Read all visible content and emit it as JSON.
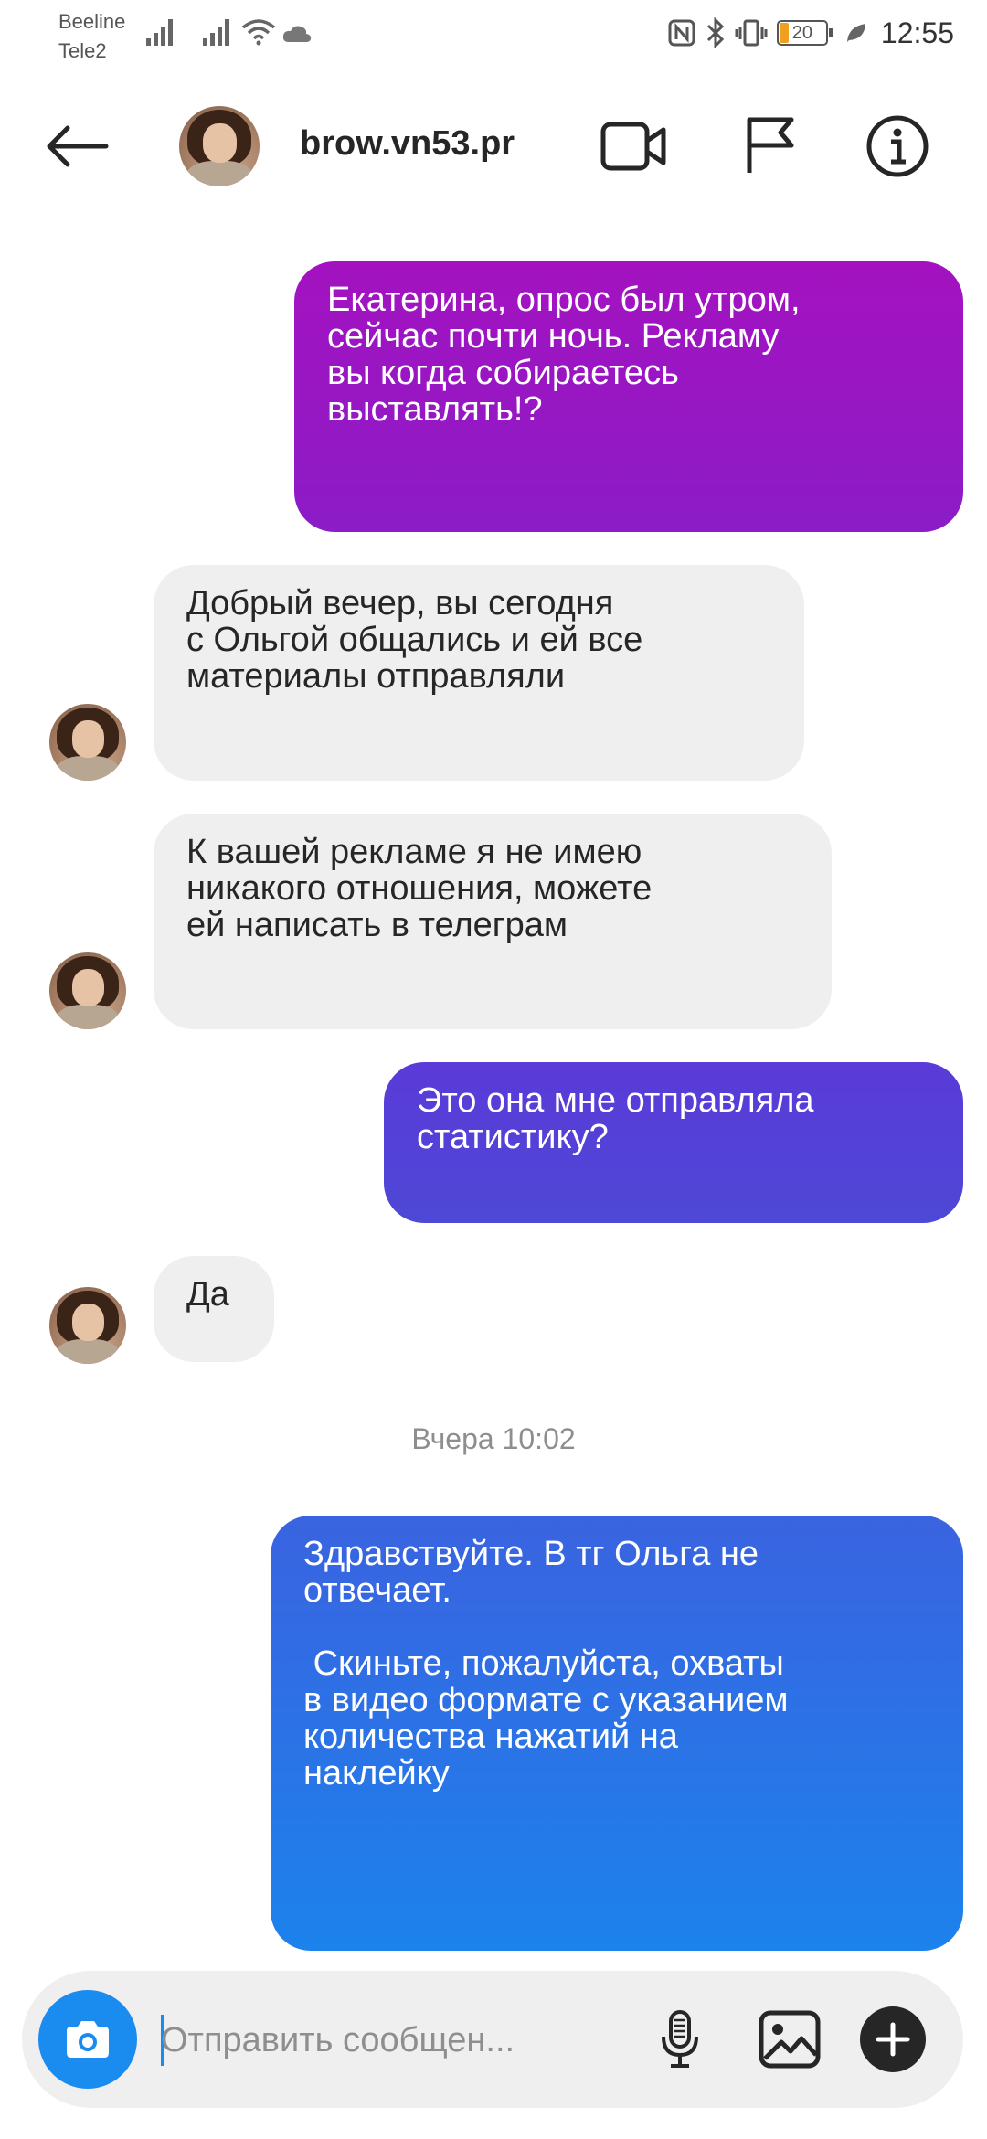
{
  "status_bar": {
    "carrier1": "Beeline",
    "carrier2": "Tele2",
    "battery": "20",
    "time": "12:55"
  },
  "header": {
    "username": "brow.vn53.pr",
    "icons": [
      "back-arrow-icon",
      "video-call-icon",
      "flag-icon",
      "info-icon"
    ]
  },
  "messages": [
    {
      "direction": "outgoing",
      "text": "Екатерина, опрос был утром,\nсейчас почти ночь. Рекламу\nвы когда собираетесь\nвыставлять!?"
    },
    {
      "direction": "incoming",
      "text": "Добрый вечер, вы сегодня\nс Ольгой общались и ей все\nматериалы отправляли"
    },
    {
      "direction": "incoming",
      "text": "К вашей рекламе я не имею\nникакого отношения, можете\nей написать в телеграм"
    },
    {
      "direction": "outgoing",
      "text": "Это она мне отправляла\nстатистику?"
    },
    {
      "direction": "incoming",
      "text": "Да"
    },
    {
      "direction": "outgoing",
      "text": "Здравствуйте. В тг Ольга не\nотвечает.\n\n Скиньте, пожалуйста, охваты\nв видео формате с указанием\nколичества нажатий на\nнаклейку"
    }
  ],
  "timestamp": "Вчера 10:02",
  "composer": {
    "placeholder": "Отправить сообщен...",
    "icons": [
      "camera-icon",
      "microphone-icon",
      "gallery-icon",
      "plus-icon"
    ]
  },
  "colors": {
    "accent_blue": "#1a8cf0",
    "bubble_purple": "#9a16c4",
    "bubble_indigo": "#5242d8",
    "bubble_blue": "#2a74e8",
    "incoming_bg": "#efefef"
  }
}
